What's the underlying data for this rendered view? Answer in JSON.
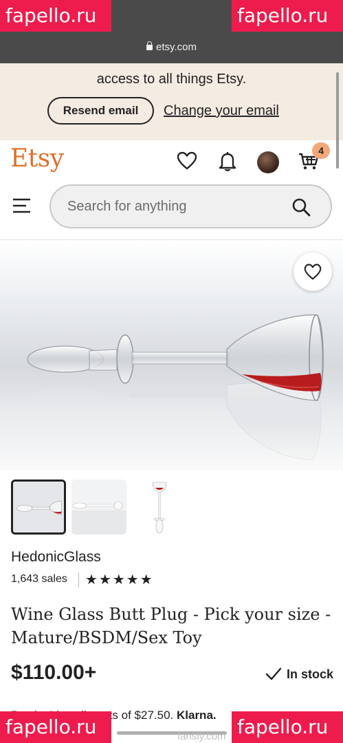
{
  "browser": {
    "url": "etsy.com"
  },
  "watermarks": {
    "text": "fapello.ru",
    "secondary": "fansly.com"
  },
  "banner": {
    "message": "access to all things Etsy.",
    "resend_label": "Resend email",
    "change_label": "Change your email"
  },
  "header": {
    "logo": "Etsy",
    "cart_count": "4",
    "brand_color": "#e0702d"
  },
  "search": {
    "placeholder": "Search for anything"
  },
  "listing": {
    "shop_name": "HedonicGlass",
    "sales": "1,643 sales",
    "rating_stars": "★★★★★",
    "rating": 5,
    "title": "Wine Glass Butt Plug - Pick your size - Mature/BSDM/Sex Toy",
    "price": "$110.00+",
    "stock": "In stock",
    "klarna_prefix": "Pay in 4 installments of $27.50.",
    "klarna_brand": "Klarna."
  },
  "icons": [
    "lock-icon",
    "heart-icon",
    "bell-icon",
    "avatar",
    "cart-icon",
    "menu-icon",
    "search-icon",
    "checkmark-icon"
  ]
}
